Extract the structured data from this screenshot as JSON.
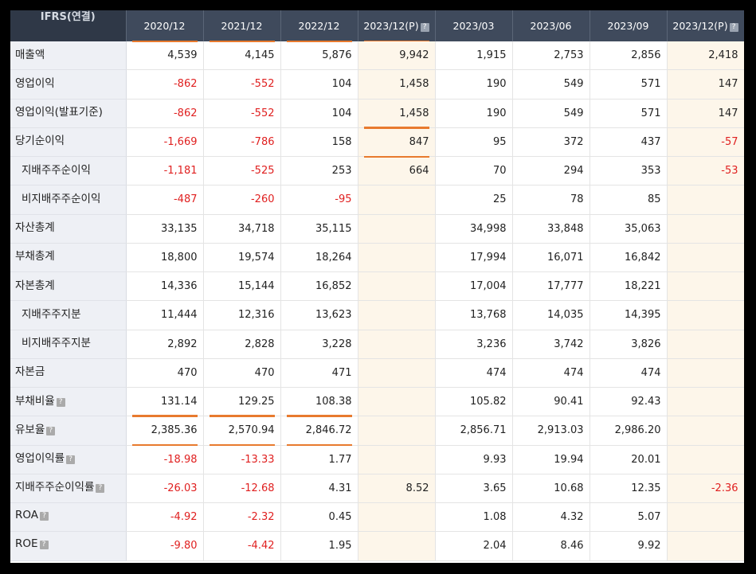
{
  "header": {
    "corner_label": "IFRS(연결)",
    "columns": [
      "2020/12",
      "2021/12",
      "2022/12",
      "2023/12(P)",
      "2023/03",
      "2023/06",
      "2023/09",
      "2023/12(P)"
    ]
  },
  "rows": [
    {
      "label": "매출액",
      "help": false,
      "values": [
        "4,539",
        "4,145",
        "5,876",
        "9,942",
        "1,915",
        "2,753",
        "2,856",
        "2,418"
      ]
    },
    {
      "label": "영업이익",
      "help": false,
      "values": [
        "-862",
        "-552",
        "104",
        "1,458",
        "190",
        "549",
        "571",
        "147"
      ]
    },
    {
      "label": "영업이익(발표기준)",
      "help": false,
      "values": [
        "-862",
        "-552",
        "104",
        "1,458",
        "190",
        "549",
        "571",
        "147"
      ]
    },
    {
      "label": "당기순이익",
      "help": false,
      "values": [
        "-1,669",
        "-786",
        "158",
        "847",
        "95",
        "372",
        "437",
        "-57"
      ]
    },
    {
      "label": "지배주주순이익",
      "help": false,
      "values": [
        "-1,181",
        "-525",
        "253",
        "664",
        "70",
        "294",
        "353",
        "-53"
      ]
    },
    {
      "label": "비지배주주순이익",
      "help": false,
      "values": [
        "-487",
        "-260",
        "-95",
        "",
        "25",
        "78",
        "85",
        ""
      ]
    },
    {
      "label": "자산총계",
      "help": false,
      "values": [
        "33,135",
        "34,718",
        "35,115",
        "",
        "34,998",
        "33,848",
        "35,063",
        ""
      ]
    },
    {
      "label": "부채총계",
      "help": false,
      "values": [
        "18,800",
        "19,574",
        "18,264",
        "",
        "17,994",
        "16,071",
        "16,842",
        ""
      ]
    },
    {
      "label": "자본총계",
      "help": false,
      "values": [
        "14,336",
        "15,144",
        "16,852",
        "",
        "17,004",
        "17,777",
        "18,221",
        ""
      ]
    },
    {
      "label": "지배주주지분",
      "help": false,
      "values": [
        "11,444",
        "12,316",
        "13,623",
        "",
        "13,768",
        "14,035",
        "14,395",
        ""
      ]
    },
    {
      "label": "비지배주주지분",
      "help": false,
      "values": [
        "2,892",
        "2,828",
        "3,228",
        "",
        "3,236",
        "3,742",
        "3,826",
        ""
      ]
    },
    {
      "label": "자본금",
      "help": false,
      "values": [
        "470",
        "470",
        "471",
        "",
        "474",
        "474",
        "474",
        ""
      ]
    },
    {
      "label": "부채비율",
      "help": true,
      "values": [
        "131.14",
        "129.25",
        "108.38",
        "",
        "105.82",
        "90.41",
        "92.43",
        ""
      ]
    },
    {
      "label": "유보율",
      "help": true,
      "values": [
        "2,385.36",
        "2,570.94",
        "2,846.72",
        "",
        "2,856.71",
        "2,913.03",
        "2,986.20",
        ""
      ]
    },
    {
      "label": "영업이익률",
      "help": true,
      "values": [
        "-18.98",
        "-13.33",
        "1.77",
        "",
        "9.93",
        "19.94",
        "20.01",
        ""
      ]
    },
    {
      "label": "지배주주순이익률",
      "help": true,
      "values": [
        "-26.03",
        "-12.68",
        "4.31",
        "8.52",
        "3.65",
        "10.68",
        "12.35",
        "-2.36"
      ]
    },
    {
      "label": "ROA",
      "help": true,
      "values": [
        "-4.92",
        "-2.32",
        "0.45",
        "",
        "1.08",
        "4.32",
        "5.07",
        ""
      ]
    },
    {
      "label": "ROE",
      "help": true,
      "values": [
        "-9.80",
        "-4.42",
        "1.95",
        "",
        "2.04",
        "8.46",
        "9.92",
        ""
      ]
    }
  ],
  "icons": {
    "help": "question-mark-icon"
  },
  "colors": {
    "negative": "#e02020",
    "estimate_bg": "#fdf6ea",
    "header_bg": "#3f4a5c",
    "highlight": "#e87a2e"
  }
}
